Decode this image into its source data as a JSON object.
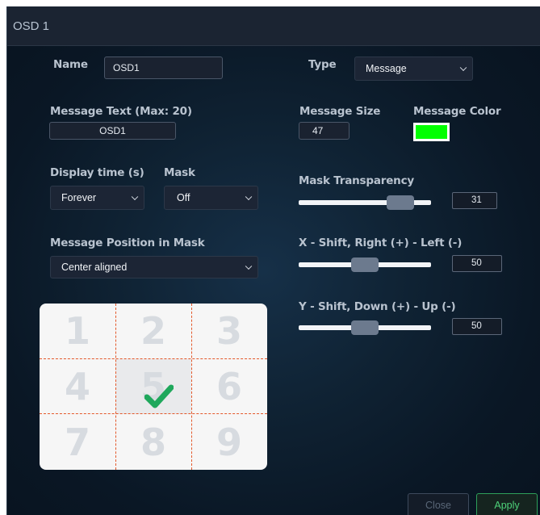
{
  "window": {
    "title": "OSD 1"
  },
  "name": {
    "label": "Name",
    "value": "OSD1"
  },
  "type": {
    "label": "Type",
    "value": "Message"
  },
  "message_text": {
    "label": "Message Text (Max: 20)",
    "value": "OSD1"
  },
  "message_size": {
    "label": "Message Size",
    "value": "47"
  },
  "message_color": {
    "label": "Message Color",
    "color": "#00ff00"
  },
  "display_time": {
    "label": "Display time (s)",
    "value": "Forever"
  },
  "mask": {
    "label": "Mask",
    "value": "Off"
  },
  "mask_transparency": {
    "label": "Mask Transparency",
    "value": "31",
    "fill_fraction": 0.84
  },
  "message_position": {
    "label": "Message Position in Mask",
    "value": "Center aligned"
  },
  "x_shift": {
    "label": "X - Shift, Right (+) - Left (-)",
    "value": "50",
    "fill_fraction": 0.5
  },
  "y_shift": {
    "label": "Y - Shift, Down (+) - Up (-)",
    "value": "50",
    "fill_fraction": 0.5
  },
  "position_grid": {
    "cells": [
      "1",
      "2",
      "3",
      "4",
      "5",
      "6",
      "7",
      "8",
      "9"
    ],
    "selected": "5",
    "check_color": "#1fa85c",
    "divider_color": "#e4582a"
  },
  "buttons": {
    "close": "Close",
    "apply": "Apply"
  }
}
